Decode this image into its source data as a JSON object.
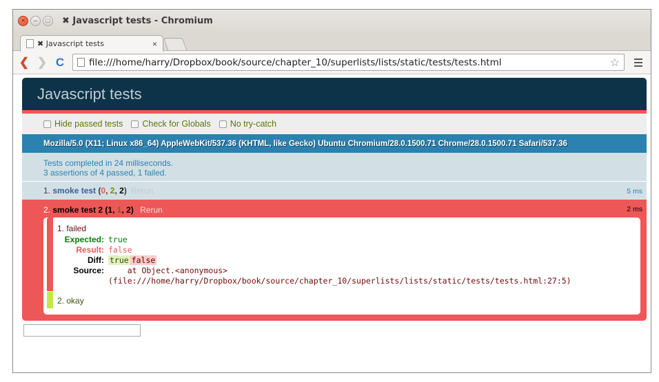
{
  "window": {
    "title": "✖ Javascript tests - Chromium",
    "close_glyph": "×",
    "min_glyph": "–",
    "max_glyph": "□"
  },
  "tabs": [
    {
      "label": "✖ Javascript tests",
      "close_glyph": "×"
    }
  ],
  "toolbar": {
    "back_glyph": "❮",
    "forward_glyph": "❯",
    "reload_glyph": "C",
    "url": "file:///home/harry/Dropbox/book/source/chapter_10/superlists/lists/static/tests/tests.html",
    "star_glyph": "☆"
  },
  "qunit": {
    "header": "Javascript tests",
    "options": [
      {
        "label": "Hide passed tests"
      },
      {
        "label": "Check for Globals"
      },
      {
        "label": "No try-catch"
      }
    ],
    "user_agent": "Mozilla/5.0 (X11; Linux x86_64) AppleWebKit/537.36 (KHTML, like Gecko) Ubuntu Chromium/28.0.1500.71 Chrome/28.0.1500.71 Safari/537.36",
    "summary_line1": "Tests completed in 24 milliseconds.",
    "summary_line2": "3 assertions of 4 passed, 1 failed.",
    "tests": [
      {
        "num": "1.",
        "name": "smoke test",
        "failed": "0",
        "passed": "2",
        "total": "2",
        "rerun": "Rerun",
        "runtime": "5 ms"
      },
      {
        "num": "2.",
        "name": "smoke test 2",
        "failed": "1",
        "passed": "1",
        "total": "2",
        "rerun": "Rerun",
        "runtime": "2 ms",
        "assertions": {
          "fail_message": "1. failed",
          "expected_label": "Expected:",
          "expected_value": "true",
          "result_label": "Result:",
          "result_value": "false",
          "diff_label": "Diff:",
          "diff_ins": "true",
          "diff_del": "false",
          "source_label": "Source:",
          "source_value": "    at Object.<anonymous>\n(file:///home/harry/Dropbox/book/source/chapter_10/superlists/lists/static/tests/tests.html:27:5)",
          "ok_message": "2. okay"
        }
      }
    ]
  },
  "colors": {
    "header_bg": "#0d3349",
    "banner_red": "#ee5757",
    "ua_blue": "#2b81af",
    "pass_bg": "#d2e0e6",
    "ok_green": "#c6e746"
  }
}
